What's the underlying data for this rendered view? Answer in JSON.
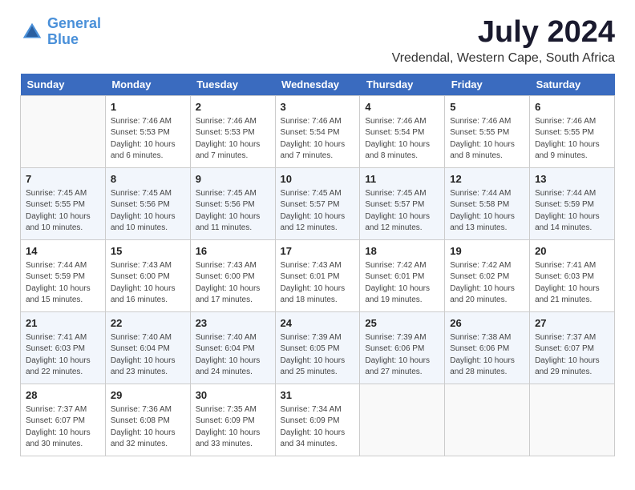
{
  "logo": {
    "line1": "General",
    "line2": "Blue"
  },
  "title": "July 2024",
  "location": "Vredendal, Western Cape, South Africa",
  "headers": [
    "Sunday",
    "Monday",
    "Tuesday",
    "Wednesday",
    "Thursday",
    "Friday",
    "Saturday"
  ],
  "weeks": [
    [
      {
        "day": "",
        "info": ""
      },
      {
        "day": "1",
        "info": "Sunrise: 7:46 AM\nSunset: 5:53 PM\nDaylight: 10 hours\nand 6 minutes."
      },
      {
        "day": "2",
        "info": "Sunrise: 7:46 AM\nSunset: 5:53 PM\nDaylight: 10 hours\nand 7 minutes."
      },
      {
        "day": "3",
        "info": "Sunrise: 7:46 AM\nSunset: 5:54 PM\nDaylight: 10 hours\nand 7 minutes."
      },
      {
        "day": "4",
        "info": "Sunrise: 7:46 AM\nSunset: 5:54 PM\nDaylight: 10 hours\nand 8 minutes."
      },
      {
        "day": "5",
        "info": "Sunrise: 7:46 AM\nSunset: 5:55 PM\nDaylight: 10 hours\nand 8 minutes."
      },
      {
        "day": "6",
        "info": "Sunrise: 7:46 AM\nSunset: 5:55 PM\nDaylight: 10 hours\nand 9 minutes."
      }
    ],
    [
      {
        "day": "7",
        "info": "Sunrise: 7:45 AM\nSunset: 5:55 PM\nDaylight: 10 hours\nand 10 minutes."
      },
      {
        "day": "8",
        "info": "Sunrise: 7:45 AM\nSunset: 5:56 PM\nDaylight: 10 hours\nand 10 minutes."
      },
      {
        "day": "9",
        "info": "Sunrise: 7:45 AM\nSunset: 5:56 PM\nDaylight: 10 hours\nand 11 minutes."
      },
      {
        "day": "10",
        "info": "Sunrise: 7:45 AM\nSunset: 5:57 PM\nDaylight: 10 hours\nand 12 minutes."
      },
      {
        "day": "11",
        "info": "Sunrise: 7:45 AM\nSunset: 5:57 PM\nDaylight: 10 hours\nand 12 minutes."
      },
      {
        "day": "12",
        "info": "Sunrise: 7:44 AM\nSunset: 5:58 PM\nDaylight: 10 hours\nand 13 minutes."
      },
      {
        "day": "13",
        "info": "Sunrise: 7:44 AM\nSunset: 5:59 PM\nDaylight: 10 hours\nand 14 minutes."
      }
    ],
    [
      {
        "day": "14",
        "info": "Sunrise: 7:44 AM\nSunset: 5:59 PM\nDaylight: 10 hours\nand 15 minutes."
      },
      {
        "day": "15",
        "info": "Sunrise: 7:43 AM\nSunset: 6:00 PM\nDaylight: 10 hours\nand 16 minutes."
      },
      {
        "day": "16",
        "info": "Sunrise: 7:43 AM\nSunset: 6:00 PM\nDaylight: 10 hours\nand 17 minutes."
      },
      {
        "day": "17",
        "info": "Sunrise: 7:43 AM\nSunset: 6:01 PM\nDaylight: 10 hours\nand 18 minutes."
      },
      {
        "day": "18",
        "info": "Sunrise: 7:42 AM\nSunset: 6:01 PM\nDaylight: 10 hours\nand 19 minutes."
      },
      {
        "day": "19",
        "info": "Sunrise: 7:42 AM\nSunset: 6:02 PM\nDaylight: 10 hours\nand 20 minutes."
      },
      {
        "day": "20",
        "info": "Sunrise: 7:41 AM\nSunset: 6:03 PM\nDaylight: 10 hours\nand 21 minutes."
      }
    ],
    [
      {
        "day": "21",
        "info": "Sunrise: 7:41 AM\nSunset: 6:03 PM\nDaylight: 10 hours\nand 22 minutes."
      },
      {
        "day": "22",
        "info": "Sunrise: 7:40 AM\nSunset: 6:04 PM\nDaylight: 10 hours\nand 23 minutes."
      },
      {
        "day": "23",
        "info": "Sunrise: 7:40 AM\nSunset: 6:04 PM\nDaylight: 10 hours\nand 24 minutes."
      },
      {
        "day": "24",
        "info": "Sunrise: 7:39 AM\nSunset: 6:05 PM\nDaylight: 10 hours\nand 25 minutes."
      },
      {
        "day": "25",
        "info": "Sunrise: 7:39 AM\nSunset: 6:06 PM\nDaylight: 10 hours\nand 27 minutes."
      },
      {
        "day": "26",
        "info": "Sunrise: 7:38 AM\nSunset: 6:06 PM\nDaylight: 10 hours\nand 28 minutes."
      },
      {
        "day": "27",
        "info": "Sunrise: 7:37 AM\nSunset: 6:07 PM\nDaylight: 10 hours\nand 29 minutes."
      }
    ],
    [
      {
        "day": "28",
        "info": "Sunrise: 7:37 AM\nSunset: 6:07 PM\nDaylight: 10 hours\nand 30 minutes."
      },
      {
        "day": "29",
        "info": "Sunrise: 7:36 AM\nSunset: 6:08 PM\nDaylight: 10 hours\nand 32 minutes."
      },
      {
        "day": "30",
        "info": "Sunrise: 7:35 AM\nSunset: 6:09 PM\nDaylight: 10 hours\nand 33 minutes."
      },
      {
        "day": "31",
        "info": "Sunrise: 7:34 AM\nSunset: 6:09 PM\nDaylight: 10 hours\nand 34 minutes."
      },
      {
        "day": "",
        "info": ""
      },
      {
        "day": "",
        "info": ""
      },
      {
        "day": "",
        "info": ""
      }
    ]
  ]
}
